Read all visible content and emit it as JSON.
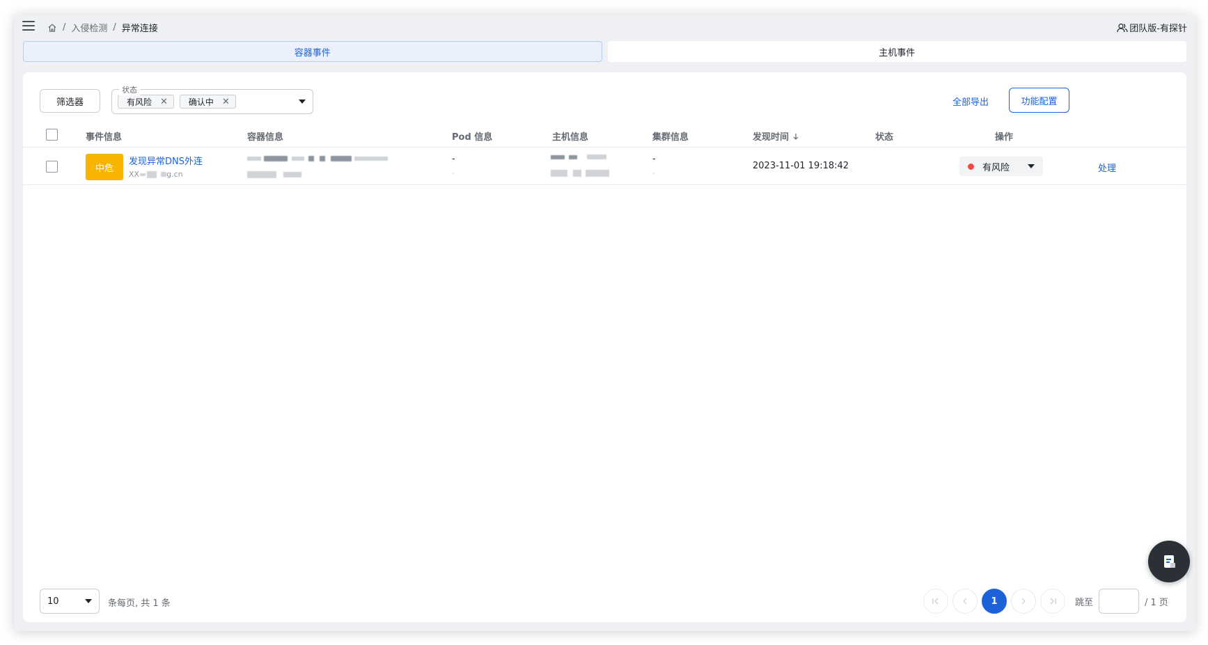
{
  "breadcrumb": {
    "level1": "入侵检测",
    "level2": "异常连接"
  },
  "user": {
    "label": "团队版-有探针"
  },
  "tabs": [
    {
      "label": "容器事件"
    },
    {
      "label": "主机事件"
    }
  ],
  "toolbar": {
    "filter_label": "筛选器",
    "status_legend": "状态",
    "status_chips": [
      "有风险",
      "确认中"
    ],
    "export_label": "全部导出",
    "config_label": "功能配置"
  },
  "table": {
    "columns": [
      "事件信息",
      "容器信息",
      "Pod 信息",
      "主机信息",
      "集群信息",
      "发现时间",
      "状态",
      "操作"
    ],
    "rows": [
      {
        "severity": "中危",
        "event_title": "发现异常DNS外连",
        "event_sub_prefix": "XX",
        "event_sub_suffix": "g.cn",
        "pod_info": "-",
        "pod_info_sub": "-",
        "cluster_info": "-",
        "cluster_info_sub": "-",
        "found_time": "2023-11-01 19:18:42",
        "status": "有风险",
        "action": "处理"
      }
    ]
  },
  "pagination": {
    "page_size": "10",
    "info": "条每页, 共 1 条",
    "current_page": "1",
    "jump_label": "跳至",
    "total_pages": "/ 1 页"
  },
  "colors": {
    "primary": "#1d62d9",
    "severity_medium": "#f7b500",
    "risk_dot": "#f54a45"
  }
}
